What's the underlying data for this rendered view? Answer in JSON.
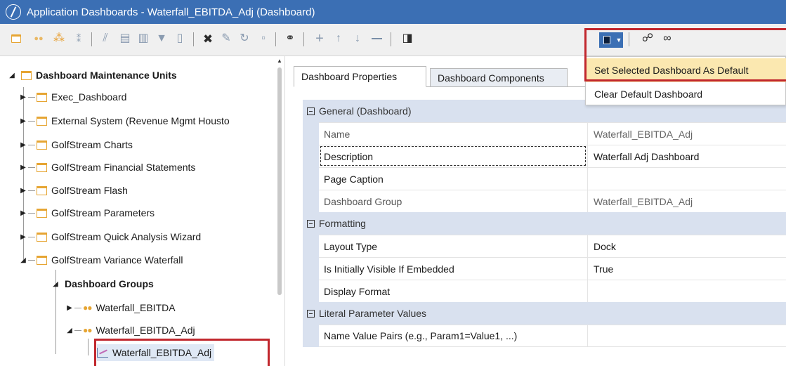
{
  "window": {
    "title": "Application Dashboards - Waterfall_EBITDA_Adj (Dashboard)"
  },
  "toolbar": {
    "icons": [
      "new-folder-icon",
      "group-icon",
      "components-icon",
      "add-component-icon",
      "chart-icon",
      "form-icon",
      "split-icon",
      "filter-icon",
      "document-icon",
      "delete-icon",
      "edit-icon",
      "refresh-icon",
      "save-icon",
      "search-icon",
      "add-icon",
      "move-up-icon",
      "move-down-icon",
      "remove-icon",
      "open-icon",
      "set-default-icon",
      "people-icon",
      "glasses-icon"
    ]
  },
  "menu": {
    "items": [
      {
        "label": "Set Selected Dashboard As Default"
      },
      {
        "label": "Clear Default Dashboard"
      }
    ]
  },
  "tree": {
    "root": "Dashboard Maintenance Units",
    "items": [
      {
        "label": "Exec_Dashboard"
      },
      {
        "label": "External System (Revenue Mgmt Housto"
      },
      {
        "label": "GolfStream Charts"
      },
      {
        "label": "GolfStream Financial Statements"
      },
      {
        "label": "GolfStream Flash"
      },
      {
        "label": "GolfStream Parameters"
      },
      {
        "label": "GolfStream Quick Analysis Wizard"
      },
      {
        "label": "GolfStream Variance Waterfall"
      }
    ],
    "groups_label": "Dashboard Groups",
    "group1": "Waterfall_EBITDA",
    "group2": "Waterfall_EBITDA_Adj",
    "dashboard": "Waterfall_EBITDA_Adj"
  },
  "tabs": [
    {
      "label": "Dashboard Properties",
      "active": true
    },
    {
      "label": "Dashboard Components",
      "active": false
    }
  ],
  "properties": {
    "general": {
      "title": "General (Dashboard)",
      "rows": [
        {
          "name": "Name",
          "value": "Waterfall_EBITDA_Adj"
        },
        {
          "name": "Description",
          "value": "Waterfall Adj Dashboard"
        },
        {
          "name": "Page Caption",
          "value": ""
        },
        {
          "name": "Dashboard Group",
          "value": "Waterfall_EBITDA_Adj"
        }
      ]
    },
    "formatting": {
      "title": "Formatting",
      "rows": [
        {
          "name": "Layout Type",
          "value": "Dock"
        },
        {
          "name": "Is Initially Visible If Embedded",
          "value": "True"
        },
        {
          "name": "Display Format",
          "value": ""
        }
      ]
    },
    "literal": {
      "title": "Literal Parameter Values",
      "rows": [
        {
          "name": "Name Value Pairs (e.g., Param1=Value1, ...)",
          "value": ""
        }
      ]
    }
  },
  "colors": {
    "titlebar": "#3b6fb4",
    "highlight": "#c1272d",
    "section": "#d9e1ef",
    "menu_hot": "#fbe8b0",
    "folder": "#e6a533"
  }
}
